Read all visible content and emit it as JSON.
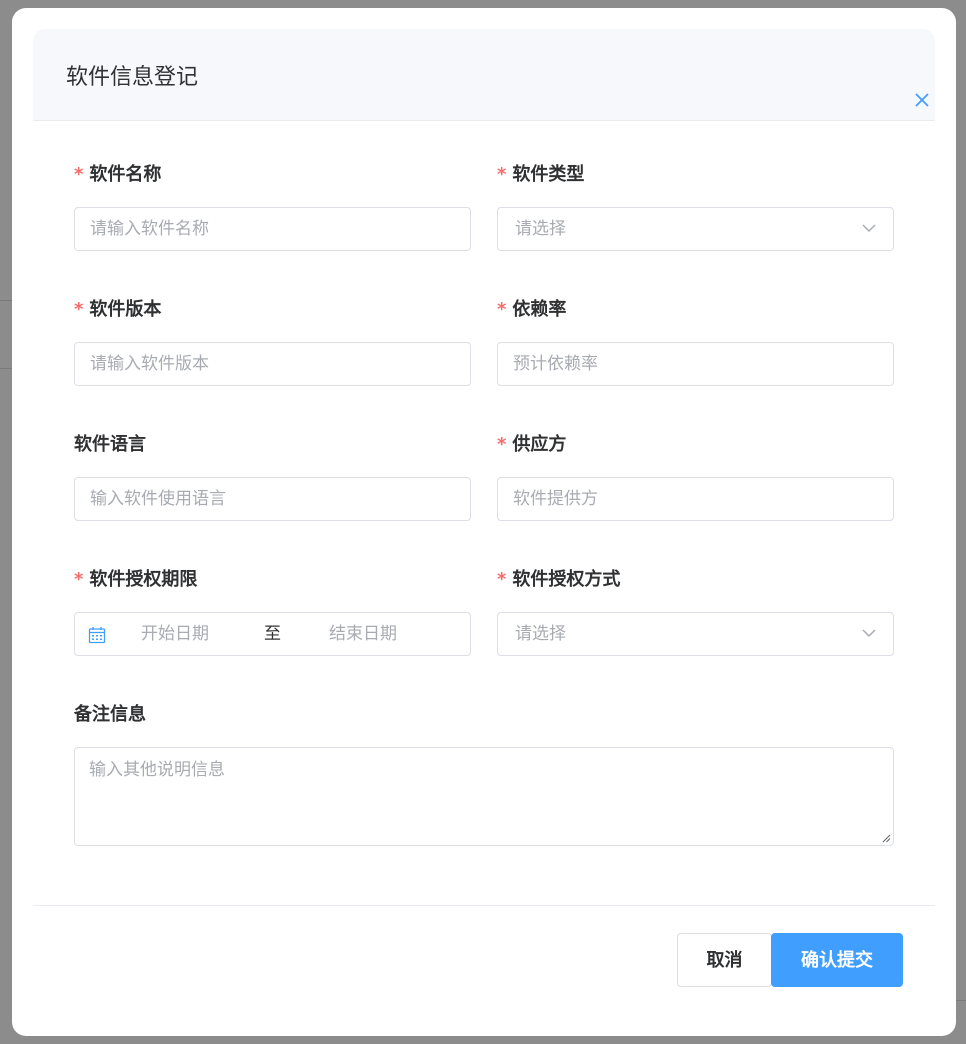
{
  "dialog": {
    "title": "软件信息登记"
  },
  "form": {
    "software_name": {
      "label": "软件名称",
      "required": true,
      "placeholder": "请输入软件名称"
    },
    "software_type": {
      "label": "软件类型",
      "required": true,
      "placeholder": "请选择"
    },
    "software_version": {
      "label": "软件版本",
      "required": true,
      "placeholder": "请输入软件版本"
    },
    "dependency_rate": {
      "label": "依赖率",
      "required": true,
      "placeholder": "预计依赖率"
    },
    "software_language": {
      "label": "软件语言",
      "required": false,
      "placeholder": "输入软件使用语言"
    },
    "supplier": {
      "label": "供应方",
      "required": true,
      "placeholder": "软件提供方"
    },
    "license_period": {
      "label": "软件授权期限",
      "required": true,
      "start_placeholder": "开始日期",
      "separator": "至",
      "end_placeholder": "结束日期"
    },
    "license_method": {
      "label": "软件授权方式",
      "required": true,
      "placeholder": "请选择"
    },
    "remarks": {
      "label": "备注信息",
      "required": false,
      "placeholder": "输入其他说明信息"
    },
    "required_mark": "*"
  },
  "footer": {
    "cancel_label": "取消",
    "submit_label": "确认提交"
  },
  "colors": {
    "primary": "#409eff",
    "required": "#f56c6c",
    "placeholder": "#a8abb2",
    "border": "#dcdfe6",
    "overlay": "#8c8c8c"
  },
  "icons": {
    "close": "close-icon",
    "select_arrow": "chevron-down-icon",
    "date": "calendar-icon"
  }
}
